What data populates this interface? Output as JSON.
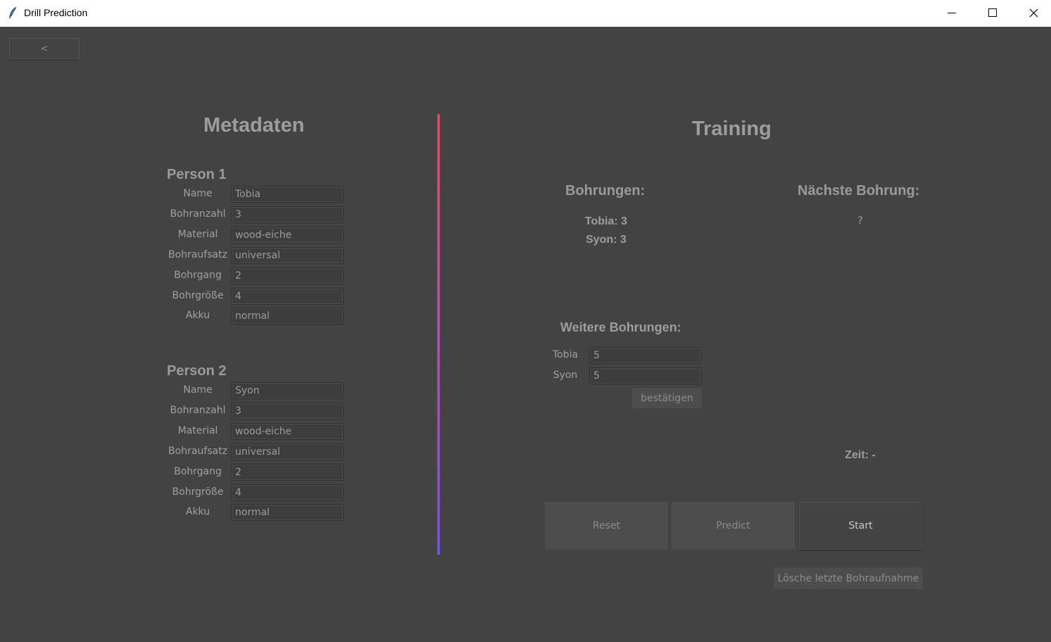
{
  "window": {
    "title": "Drill Prediction"
  },
  "nav": {
    "back_label": "<"
  },
  "metadata": {
    "title": "Metadaten",
    "persons": [
      {
        "heading": "Person 1",
        "fields": [
          {
            "label": "Name",
            "value": "Tobia"
          },
          {
            "label": "Bohranzahl",
            "value": "3"
          },
          {
            "label": "Material",
            "value": "wood-eiche"
          },
          {
            "label": "Bohraufsatz",
            "value": "universal"
          },
          {
            "label": "Bohrgang",
            "value": "2"
          },
          {
            "label": "Bohrgröße",
            "value": "4"
          },
          {
            "label": "Akku",
            "value": "normal"
          }
        ]
      },
      {
        "heading": "Person 2",
        "fields": [
          {
            "label": "Name",
            "value": "Syon"
          },
          {
            "label": "Bohranzahl",
            "value": "3"
          },
          {
            "label": "Material",
            "value": "wood-eiche"
          },
          {
            "label": "Bohraufsatz",
            "value": "universal"
          },
          {
            "label": "Bohrgang",
            "value": "2"
          },
          {
            "label": "Bohrgröße",
            "value": "4"
          },
          {
            "label": "Akku",
            "value": "normal"
          }
        ]
      }
    ]
  },
  "training": {
    "title": "Training",
    "drillings_heading": "Bohrungen:",
    "drillings": [
      "Tobia: 3",
      "Syon: 3"
    ],
    "next_heading": "Nächste Bohrung:",
    "next_value": "?",
    "more_heading": "Weitere Bohrungen:",
    "more_fields": [
      {
        "label": "Tobia",
        "value": "5"
      },
      {
        "label": "Syon",
        "value": "5"
      }
    ],
    "confirm_label": "bestätigen",
    "time_label": "Zeit: -",
    "reset_label": "Reset",
    "predict_label": "Predict",
    "start_label": "Start",
    "delete_label": "Lösche letzte Bohraufnahme"
  },
  "colors": {
    "divider_top": "#e0465a",
    "divider_bottom": "#6f4ee8",
    "background": "#434343"
  }
}
